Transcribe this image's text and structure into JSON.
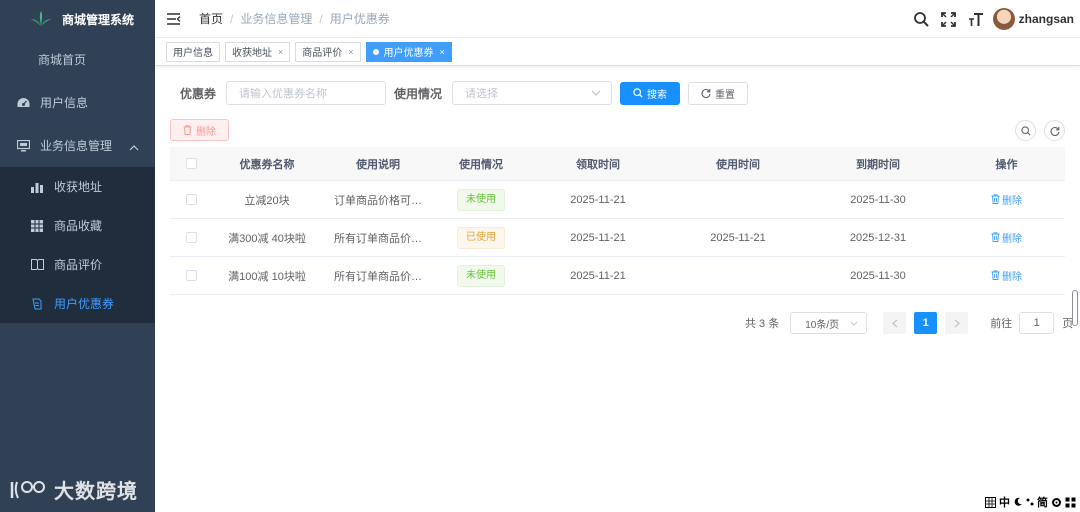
{
  "app": {
    "title": "商城管理系统"
  },
  "sidebar": {
    "items": [
      {
        "label": "商城首页",
        "icon": "none"
      },
      {
        "label": "用户信息",
        "icon": "dashboard-icon"
      },
      {
        "label": "业务信息管理",
        "icon": "monitor-icon"
      }
    ],
    "submenu": [
      {
        "label": "收获地址",
        "icon": "bar-chart-icon"
      },
      {
        "label": "商品收藏",
        "icon": "grid-icon"
      },
      {
        "label": "商品评价",
        "icon": "book-icon"
      },
      {
        "label": "用户优惠券",
        "icon": "coupon-icon",
        "active": true
      }
    ],
    "watermark": "大数跨境"
  },
  "navbar": {
    "breadcrumb": [
      "首页",
      "业务信息管理",
      "用户优惠券"
    ],
    "username": "zhangsan"
  },
  "tags": [
    {
      "label": "用户信息",
      "closable": false
    },
    {
      "label": "收获地址",
      "closable": true
    },
    {
      "label": "商品评价",
      "closable": true
    },
    {
      "label": "用户优惠券",
      "closable": true,
      "active": true
    }
  ],
  "search": {
    "coupon_label": "优惠券",
    "coupon_placeholder": "请输入优惠券名称",
    "usage_label": "使用情况",
    "usage_placeholder": "请选择",
    "search_btn": "搜索",
    "reset_btn": "重置"
  },
  "toolbar": {
    "delete_btn": "删除"
  },
  "table": {
    "headers": [
      "优惠券名称",
      "使用说明",
      "使用情况",
      "领取时间",
      "使用时间",
      "到期时间",
      "操作"
    ],
    "rows": [
      {
        "name": "立减20块",
        "desc": "订单商品价格可…",
        "status": "未使用",
        "received": "2025-11-21",
        "used": "",
        "expires": "2025-11-30",
        "op": "删除"
      },
      {
        "name": "满300减 40块啦",
        "desc": "所有订单商品价…",
        "status": "已使用",
        "received": "2025-11-21",
        "used": "2025-11-21",
        "expires": "2025-12-31",
        "op": "删除"
      },
      {
        "name": "满100减 10块啦",
        "desc": "所有订单商品价…",
        "status": "未使用",
        "received": "2025-11-21",
        "used": "",
        "expires": "2025-11-30",
        "op": "删除"
      }
    ]
  },
  "pagination": {
    "total": "共 3 条",
    "page_size": "10条/页",
    "current": "1",
    "goto_label": "前往",
    "goto_value": "1",
    "page_unit": "页"
  },
  "ime": [
    "中",
    "简"
  ],
  "colors": {
    "primary": "#1890ff",
    "sidebar_bg": "#304156",
    "success": "#67c23a",
    "warning": "#e6a23c"
  }
}
